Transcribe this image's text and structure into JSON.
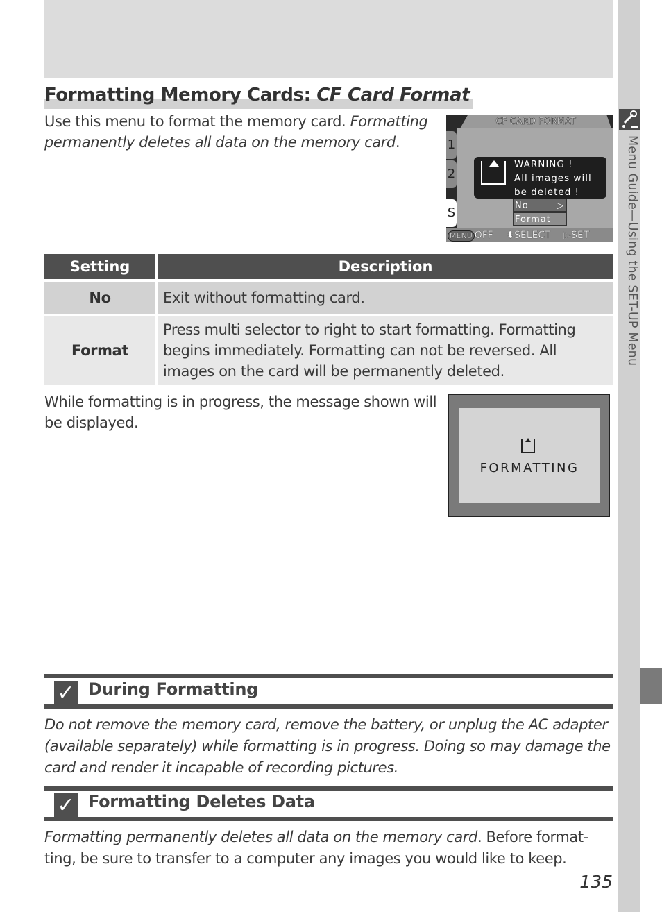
{
  "side_tab": {
    "label": "Menu Guide—Using the SET-UP Menu",
    "icon": "wrench-icon"
  },
  "title": {
    "main": "Formatting Memory Cards: ",
    "italic": "CF Card Format"
  },
  "intro": {
    "plain": "Use this menu to format the memory card. ",
    "italic": "Formatting permanently deletes all data on the memory card",
    "end": "."
  },
  "camera_screen_menu": {
    "title": "CF CARD FORMAT",
    "tabs": [
      "1",
      "2",
      "S"
    ],
    "warning_lines": [
      "WARNING !",
      "All images will",
      "be deleted !"
    ],
    "options": [
      {
        "label": "No",
        "selected": true,
        "arrow": "▷"
      },
      {
        "label": "Format",
        "selected": false
      }
    ],
    "footer": {
      "menu_badge": "MENU",
      "off": "OFF",
      "select": "⬍SELECT",
      "set": "▷SET"
    }
  },
  "settings_table": {
    "headers": [
      "Setting",
      "Description"
    ],
    "rows": [
      {
        "setting": "No",
        "description": "Exit without formatting card."
      },
      {
        "setting": "Format",
        "description": "Press multi selector to right to start formatting. Formatting begins immediately. Formatting can not be reversed. All images on the card will be permanently deleted."
      }
    ]
  },
  "progress_text": "While formatting is in progress, the message shown will be displayed.",
  "camera_screen_formatting": {
    "message": "FORMATTING"
  },
  "notes": [
    {
      "icon": "check-icon",
      "title": "During Formatting",
      "body": "Do not remove the memory card, remove the battery, or unplug the AC adapter (available separately) while formatting is in progress. Doing so may damage the card and render it incapable of recording pictures."
    },
    {
      "icon": "check-icon",
      "title": "Formatting Deletes Data",
      "body_italic": "Formatting permanently deletes all data on the memory card",
      "body_plain": ".  Before format-ting, be sure to transfer to a computer any images you would like to keep."
    }
  ],
  "page_number": "135"
}
